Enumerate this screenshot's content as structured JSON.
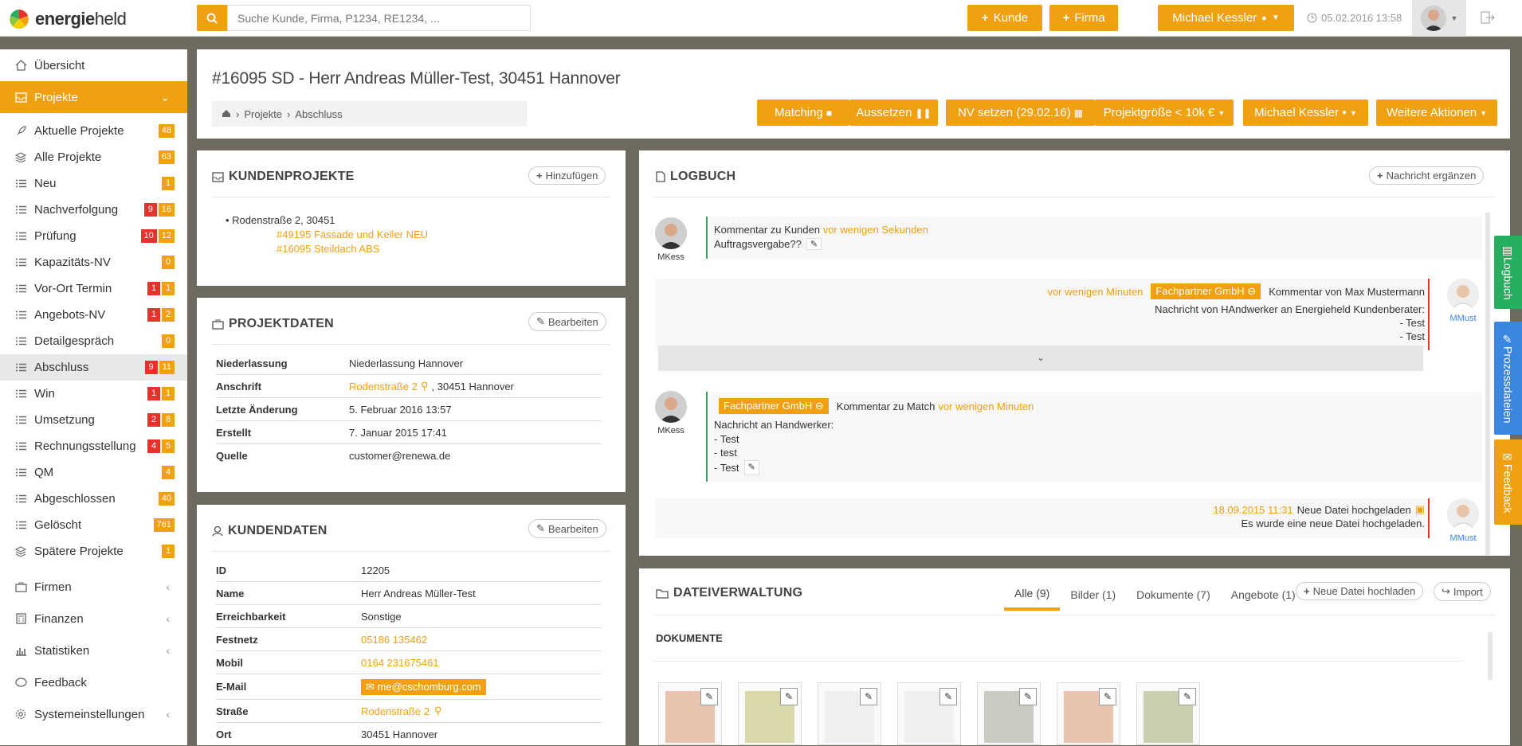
{
  "brand": {
    "name_bold": "energie",
    "name_rest": "held"
  },
  "search": {
    "placeholder": "Suche Kunde, Firma, P1234, RE1234, ..."
  },
  "topbar": {
    "add_customer": "Kunde",
    "add_company": "Firma",
    "user_name": "Michael Kessler",
    "timestamp": "05.02.2016 13:58"
  },
  "sidebar": {
    "overview": "Übersicht",
    "projects": "Projekte",
    "items": [
      {
        "label": "Aktuelle Projekte",
        "icon": "rocket-icon",
        "badges": [
          {
            "v": "48",
            "c": "o"
          }
        ]
      },
      {
        "label": "Alle Projekte",
        "icon": "layers-icon",
        "badges": [
          {
            "v": "63",
            "c": "o"
          }
        ]
      },
      {
        "label": "Neu",
        "icon": "list-icon",
        "badges": [
          {
            "v": "1",
            "c": "o"
          }
        ]
      },
      {
        "label": "Nachverfolgung",
        "icon": "list-icon",
        "badges": [
          {
            "v": "9",
            "c": "r"
          },
          {
            "v": "16",
            "c": "o"
          }
        ]
      },
      {
        "label": "Prüfung",
        "icon": "list-icon",
        "badges": [
          {
            "v": "10",
            "c": "r"
          },
          {
            "v": "12",
            "c": "o"
          }
        ]
      },
      {
        "label": "Kapazitäts-NV",
        "icon": "list-icon",
        "badges": [
          {
            "v": "0",
            "c": "o"
          }
        ]
      },
      {
        "label": "Vor-Ort Termin",
        "icon": "list-icon",
        "badges": [
          {
            "v": "1",
            "c": "r"
          },
          {
            "v": "1",
            "c": "o"
          }
        ]
      },
      {
        "label": "Angebots-NV",
        "icon": "list-icon",
        "badges": [
          {
            "v": "1",
            "c": "r"
          },
          {
            "v": "2",
            "c": "o"
          }
        ]
      },
      {
        "label": "Detailgespräch",
        "icon": "list-icon",
        "badges": [
          {
            "v": "0",
            "c": "o"
          }
        ]
      },
      {
        "label": "Abschluss",
        "icon": "list-icon",
        "badges": [
          {
            "v": "9",
            "c": "r"
          },
          {
            "v": "11",
            "c": "o"
          }
        ],
        "selected": true
      },
      {
        "label": "Win",
        "icon": "list-icon",
        "badges": [
          {
            "v": "1",
            "c": "r"
          },
          {
            "v": "1",
            "c": "o"
          }
        ]
      },
      {
        "label": "Umsetzung",
        "icon": "list-icon",
        "badges": [
          {
            "v": "2",
            "c": "r"
          },
          {
            "v": "8",
            "c": "o"
          }
        ]
      },
      {
        "label": "Rechnungsstellung",
        "icon": "list-icon",
        "badges": [
          {
            "v": "4",
            "c": "r"
          },
          {
            "v": "5",
            "c": "o"
          }
        ]
      },
      {
        "label": "QM",
        "icon": "list-icon",
        "badges": [
          {
            "v": "4",
            "c": "o"
          }
        ]
      },
      {
        "label": "Abgeschlossen",
        "icon": "list-icon",
        "badges": [
          {
            "v": "40",
            "c": "o"
          }
        ]
      },
      {
        "label": "Gelöscht",
        "icon": "list-icon",
        "badges": [
          {
            "v": "761",
            "c": "o"
          }
        ]
      },
      {
        "label": "Spätere Projekte",
        "icon": "layers-icon",
        "badges": [
          {
            "v": "1",
            "c": "o"
          }
        ]
      }
    ],
    "firms": "Firmen",
    "finances": "Finanzen",
    "stats": "Statistiken",
    "feedback": "Feedback",
    "settings": "Systemeinstellungen"
  },
  "page": {
    "title": "#16095 SD - Herr Andreas Müller-Test, 30451 Hannover",
    "breadcrumb": [
      "Projekte",
      "Abschluss"
    ],
    "actions": {
      "matching": "Matching",
      "pause": "Aussetzen",
      "nv": "NV setzen (29.02.16)",
      "size": "Projektgröße < 10k €",
      "owner": "Michael Kessler",
      "more": "Weitere Aktionen"
    }
  },
  "kundenprojekte": {
    "title": "Kundenprojekte",
    "add": "Hinzufügen",
    "address": "Rodenstraße 2, 30451",
    "links": [
      "#49195 Fassade und Keller NEU",
      "#16095 Steildach ABS"
    ]
  },
  "projektdaten": {
    "title": "Projektdaten",
    "edit": "Bearbeiten",
    "rows": {
      "k1": "Niederlassung",
      "v1": "Niederlassung Hannover",
      "k2": "Anschrift",
      "v2a": "Rodenstraße 2",
      "v2b": ", 30451 Hannover",
      "k3": "Letzte Änderung",
      "v3": "5. Februar 2016 13:57",
      "k4": "Erstellt",
      "v4": "7. Januar 2015 17:41",
      "k5": "Quelle",
      "v5": "customer@renewa.de"
    }
  },
  "kundendaten": {
    "title": "Kundendaten",
    "edit": "Bearbeiten",
    "rows": {
      "k1": "ID",
      "v1": "12205",
      "k2": "Name",
      "v2": "Herr Andreas Müller-Test",
      "k3": "Erreichbarkeit",
      "v3": "Sonstige",
      "k4": "Festnetz",
      "v4": "05186 135462",
      "k5": "Mobil",
      "v5": "0164 231675461",
      "k6": "E-Mail",
      "v6": "me@cschomburg.com",
      "k7": "Straße",
      "v7": "Rodenstraße 2",
      "k8": "Ort",
      "v8": "30451 Hannover"
    }
  },
  "logbuch": {
    "title": "Logbuch",
    "add": "Nachricht ergänzen",
    "e1": {
      "user": "MKess",
      "label": "Kommentar zu Kunden",
      "time": "vor wenigen Sekunden",
      "text": "Auftragsvergabe??"
    },
    "e2": {
      "user": "MMust",
      "time": "vor wenigen Minuten",
      "tag": "Fachpartner GmbH",
      "label": "Kommentar von Max Mustermann",
      "l1": "Nachricht von HAndwerker an Energieheld Kundenberater:",
      "l2": "- Test",
      "l3": "- Test"
    },
    "e3": {
      "user": "MKess",
      "tag": "Fachpartner GmbH",
      "label": "Kommentar zu Match",
      "time": "vor wenigen Minuten",
      "l1": "Nachricht an Handwerker:",
      "l2": "- Test",
      "l3": "- test",
      "l4": "- Test"
    },
    "e4": {
      "user": "MMust",
      "time": "18.09.2015 11:31",
      "label": "Neue Datei hochgeladen",
      "text": "Es wurde eine neue Datei hochgeladen."
    }
  },
  "dateien": {
    "title": "Dateiverwaltung",
    "tabs": [
      "Alle (9)",
      "Bilder (1)",
      "Dokumente (7)",
      "Angebote (1)"
    ],
    "upload": "Neue Datei hochladen",
    "import": "Import",
    "section": "Dokumente"
  },
  "sidetabs": {
    "log": "Logbuch",
    "process": "Prozessdateien",
    "feedback": "Feedback"
  },
  "colors": {
    "accent": "#f0a010",
    "danger": "#e5322d",
    "success": "#27ae60",
    "info": "#3a86e0"
  }
}
